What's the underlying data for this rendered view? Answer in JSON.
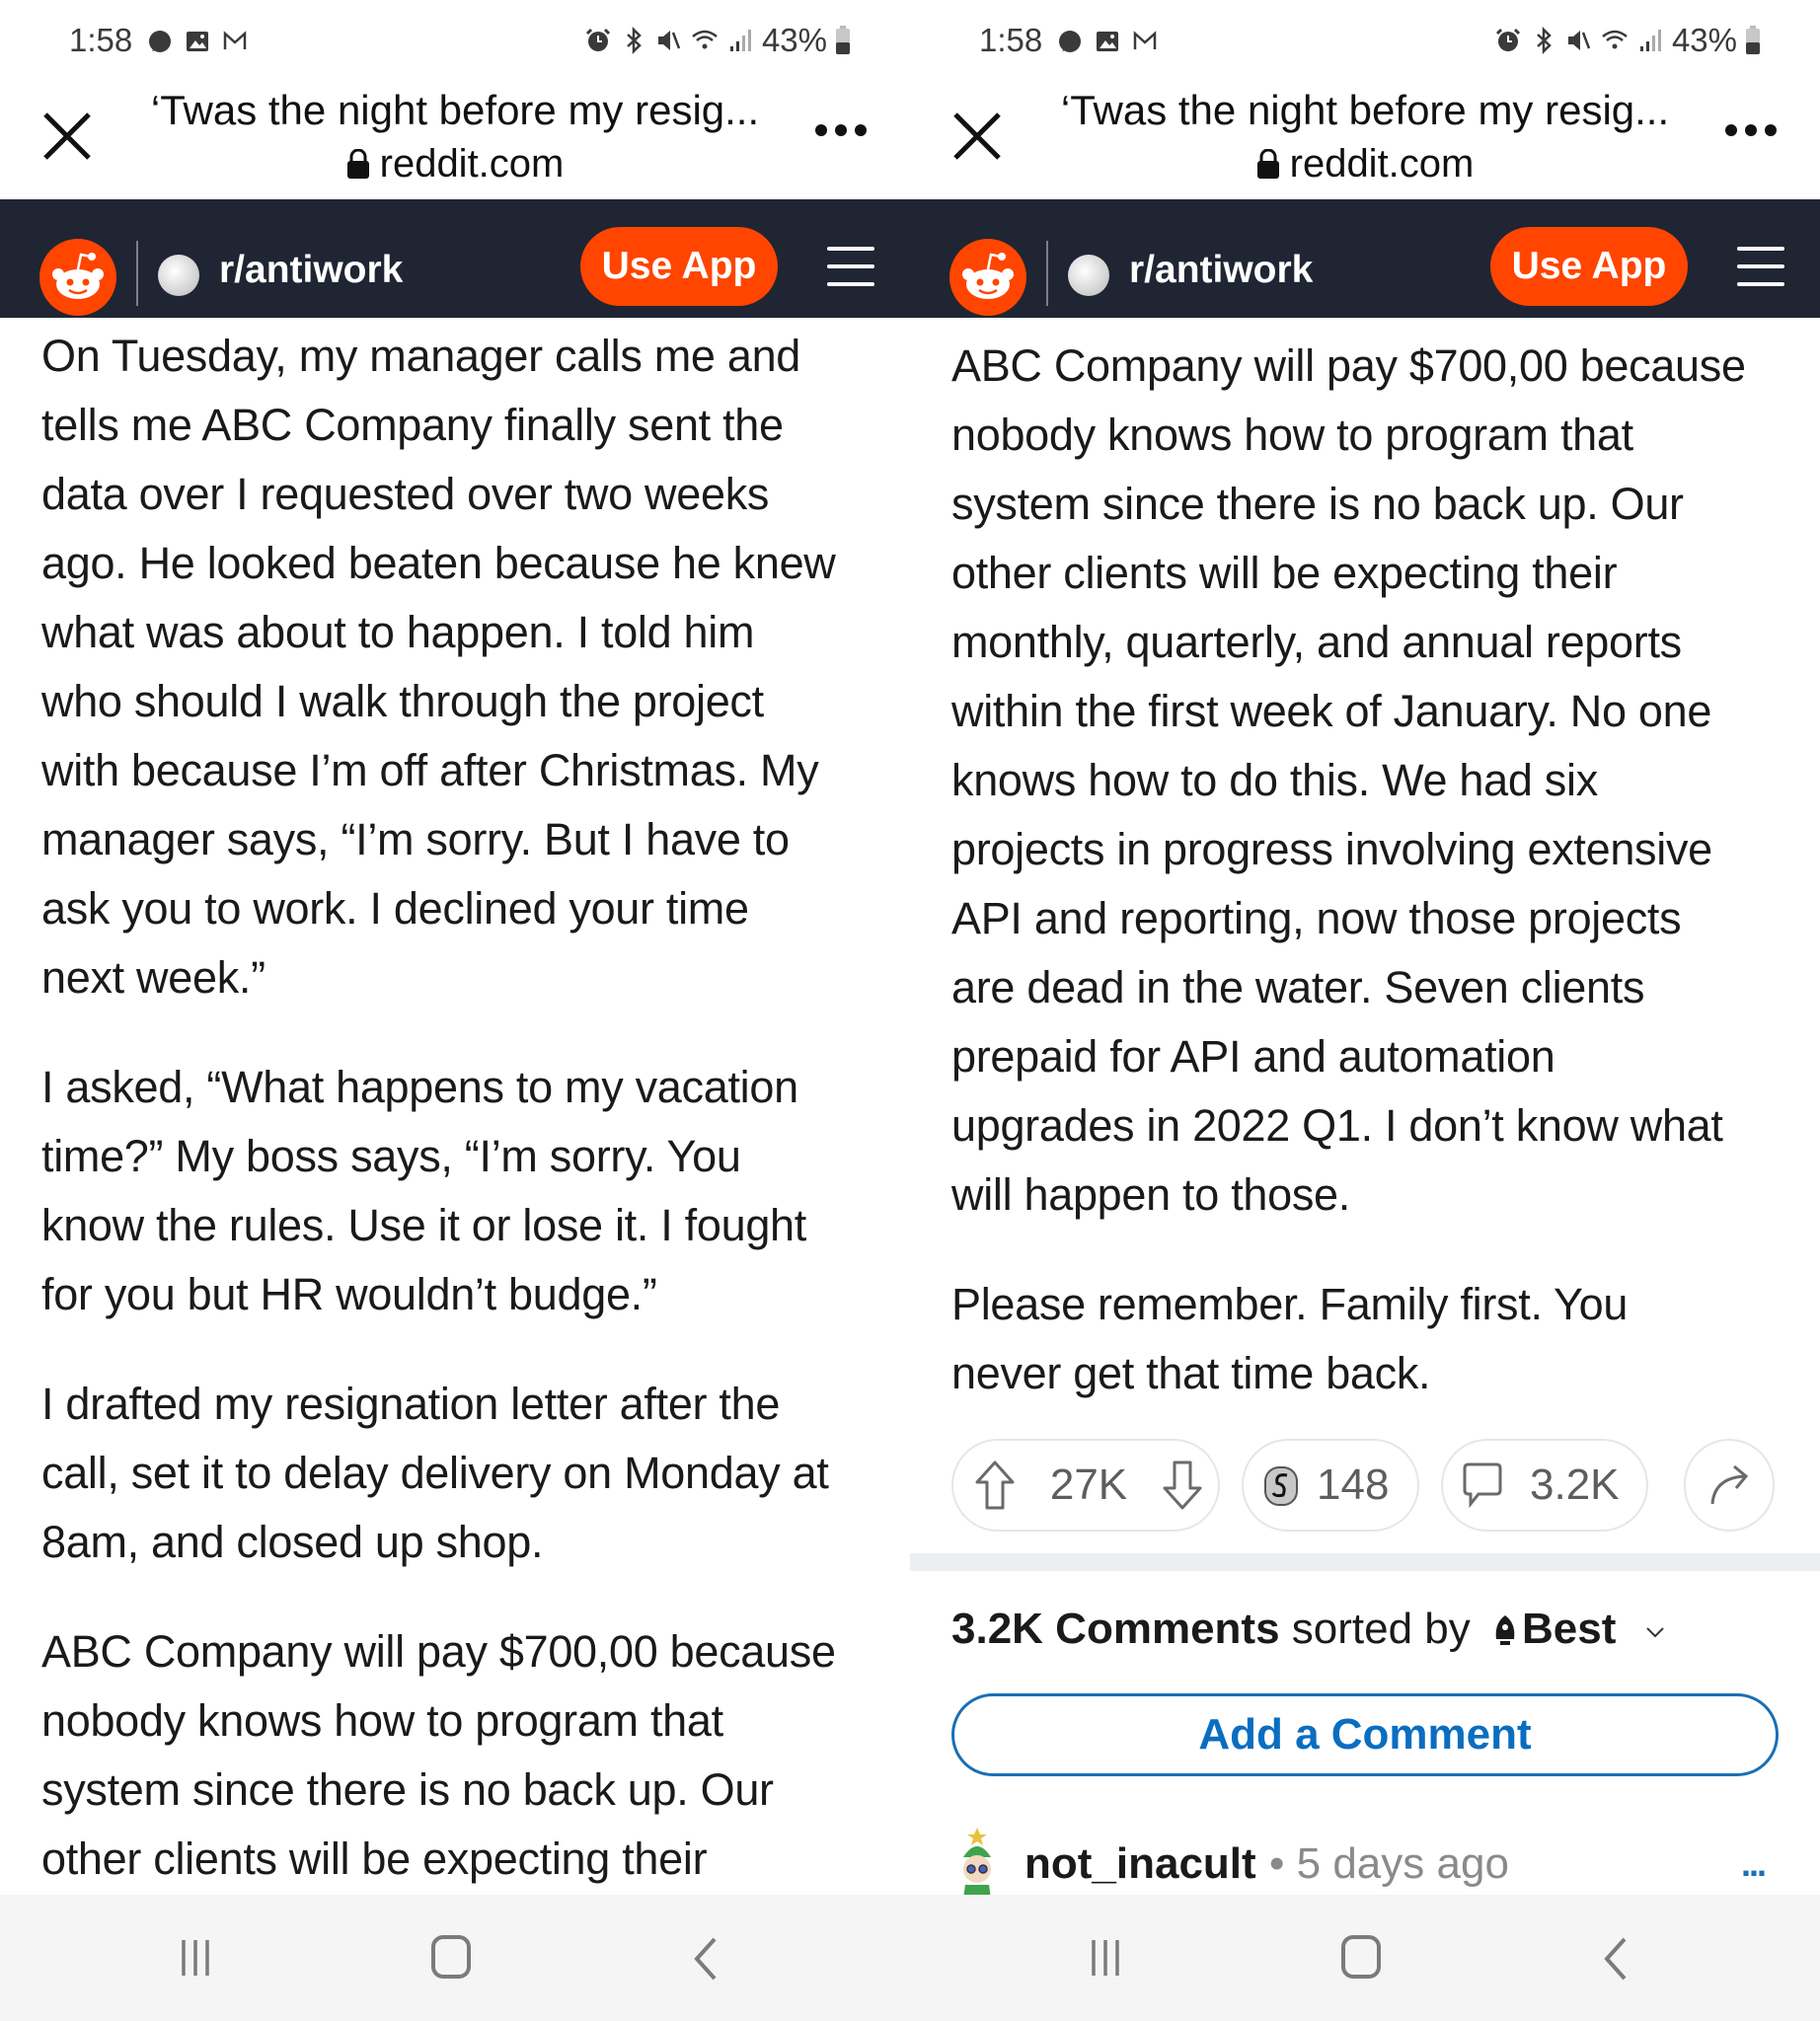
{
  "status_bar": {
    "time": "1:58",
    "left_icons": [
      "chat-bubble-icon",
      "gallery-icon",
      "gmail-icon"
    ],
    "right_icons": [
      "alarm-icon",
      "bluetooth-icon",
      "mute-icon",
      "wifi-icon",
      "signal-icon"
    ],
    "battery": "43%"
  },
  "browser": {
    "title": "‘Twas the night before my resig...",
    "url": "reddit.com"
  },
  "reddit_header": {
    "subreddit": "r/antiwork",
    "use_app_label": "Use App"
  },
  "left_panel": {
    "paragraphs": [
      [
        "On Tuesday, my manager calls me and",
        "tells me ABC Company finally sent the",
        "data over I requested over two weeks",
        "ago. He looked beaten because he knew",
        "what was about to happen. I told him",
        "who should I walk through the project",
        "with because I’m off after Christmas. My",
        "manager says, “I’m sorry. But I have to",
        "ask you to work. I declined your time",
        "next week.”"
      ],
      [
        "I asked, “What happens to my vacation",
        "time?” My boss says, “I’m sorry. You",
        "know the rules. Use it or lose it. I fought",
        "for you but HR wouldn’t budge.”"
      ],
      [
        "I drafted my resignation letter after the",
        "call, set it to delay delivery on Monday at",
        "8am, and closed up shop."
      ],
      [
        "ABC Company will pay $700,00 because",
        "nobody knows how to program that",
        "system since there is no back up. Our",
        "other clients will be expecting their"
      ]
    ]
  },
  "right_panel": {
    "paragraphs": [
      [
        "ABC Company will pay $700,00 because",
        "nobody knows how to program that",
        "system since there is no back up. Our",
        "other clients will be expecting their",
        "monthly, quarterly, and annual reports",
        "within the first week of January. No one",
        "knows how to do this. We had six",
        "projects in progress involving extensive",
        "API and reporting, now those projects",
        "are dead in the water. Seven clients",
        "prepaid for API and automation",
        "upgrades in 2022 Q1. I don’t know what",
        "will happen to those."
      ],
      [
        "Please remember. Family first. You",
        "never get that time back."
      ]
    ],
    "actions": {
      "votes": "27K",
      "awards": "148",
      "comments": "3.2K"
    },
    "comments_section": {
      "count": "3.2K Comments",
      "sorted_by_label": "sorted by",
      "sort": "Best",
      "add_comment_label": "Add a Comment"
    },
    "first_comment": {
      "username": "not_inacult",
      "separator": "•",
      "age": "5 days ago",
      "more": "..."
    }
  },
  "colors": {
    "brand_orange": "#ff4500",
    "header_dark": "#1f2533",
    "link_blue": "#0a6ec0"
  }
}
